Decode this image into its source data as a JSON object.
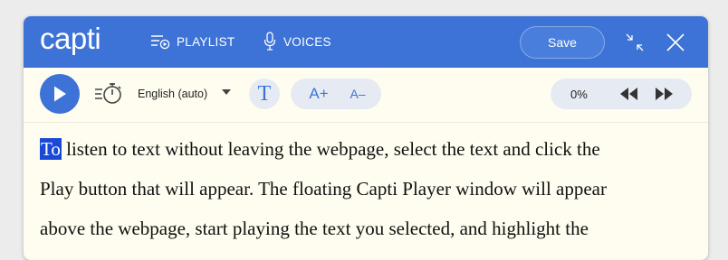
{
  "header": {
    "logo_text": "capti",
    "nav": [
      {
        "label": "PLAYLIST",
        "icon": "playlist-icon"
      },
      {
        "label": "VOICES",
        "icon": "microphone-icon"
      }
    ],
    "save_label": "Save",
    "icons": [
      "collapse-icon",
      "close-icon"
    ],
    "brand_color": "#3d73d6"
  },
  "toolbar": {
    "play_icon": "play-icon",
    "speed_icon": "speed-timer-icon",
    "language": "English (auto)",
    "font_label": "T",
    "increase_font_label": "A+",
    "decrease_font_label": "A–",
    "progress": "0%",
    "rewind_icon": "rewind-icon",
    "forward_icon": "fast-forward-icon"
  },
  "content": {
    "highlighted_word": "To",
    "line1_rest": " listen to text without leaving the webpage, select the text and click the",
    "line2": "Play button that will appear. The floating Capti Player window will appear",
    "line3": "above the webpage, start playing the text you selected, and highlight the",
    "highlight_color": "#1a49d8"
  }
}
